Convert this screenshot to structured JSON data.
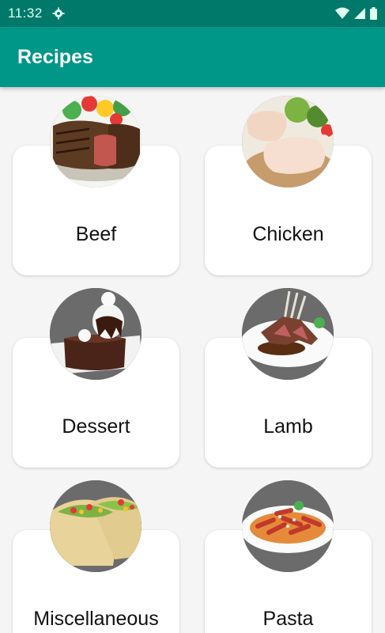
{
  "status_bar": {
    "time": "11:32"
  },
  "app_bar": {
    "title": "Recipes"
  },
  "categories": [
    {
      "label": "Beef",
      "image": "beef-photo"
    },
    {
      "label": "Chicken",
      "image": "chicken-photo"
    },
    {
      "label": "Dessert",
      "image": "dessert-photo"
    },
    {
      "label": "Lamb",
      "image": "lamb-photo"
    },
    {
      "label": "Miscellaneous",
      "image": "tacos-photo"
    },
    {
      "label": "Pasta",
      "image": "pasta-photo"
    }
  ],
  "colors": {
    "primary": "#009688",
    "primary_dark": "#00796b",
    "background": "#f5f5f5",
    "card": "#ffffff"
  }
}
